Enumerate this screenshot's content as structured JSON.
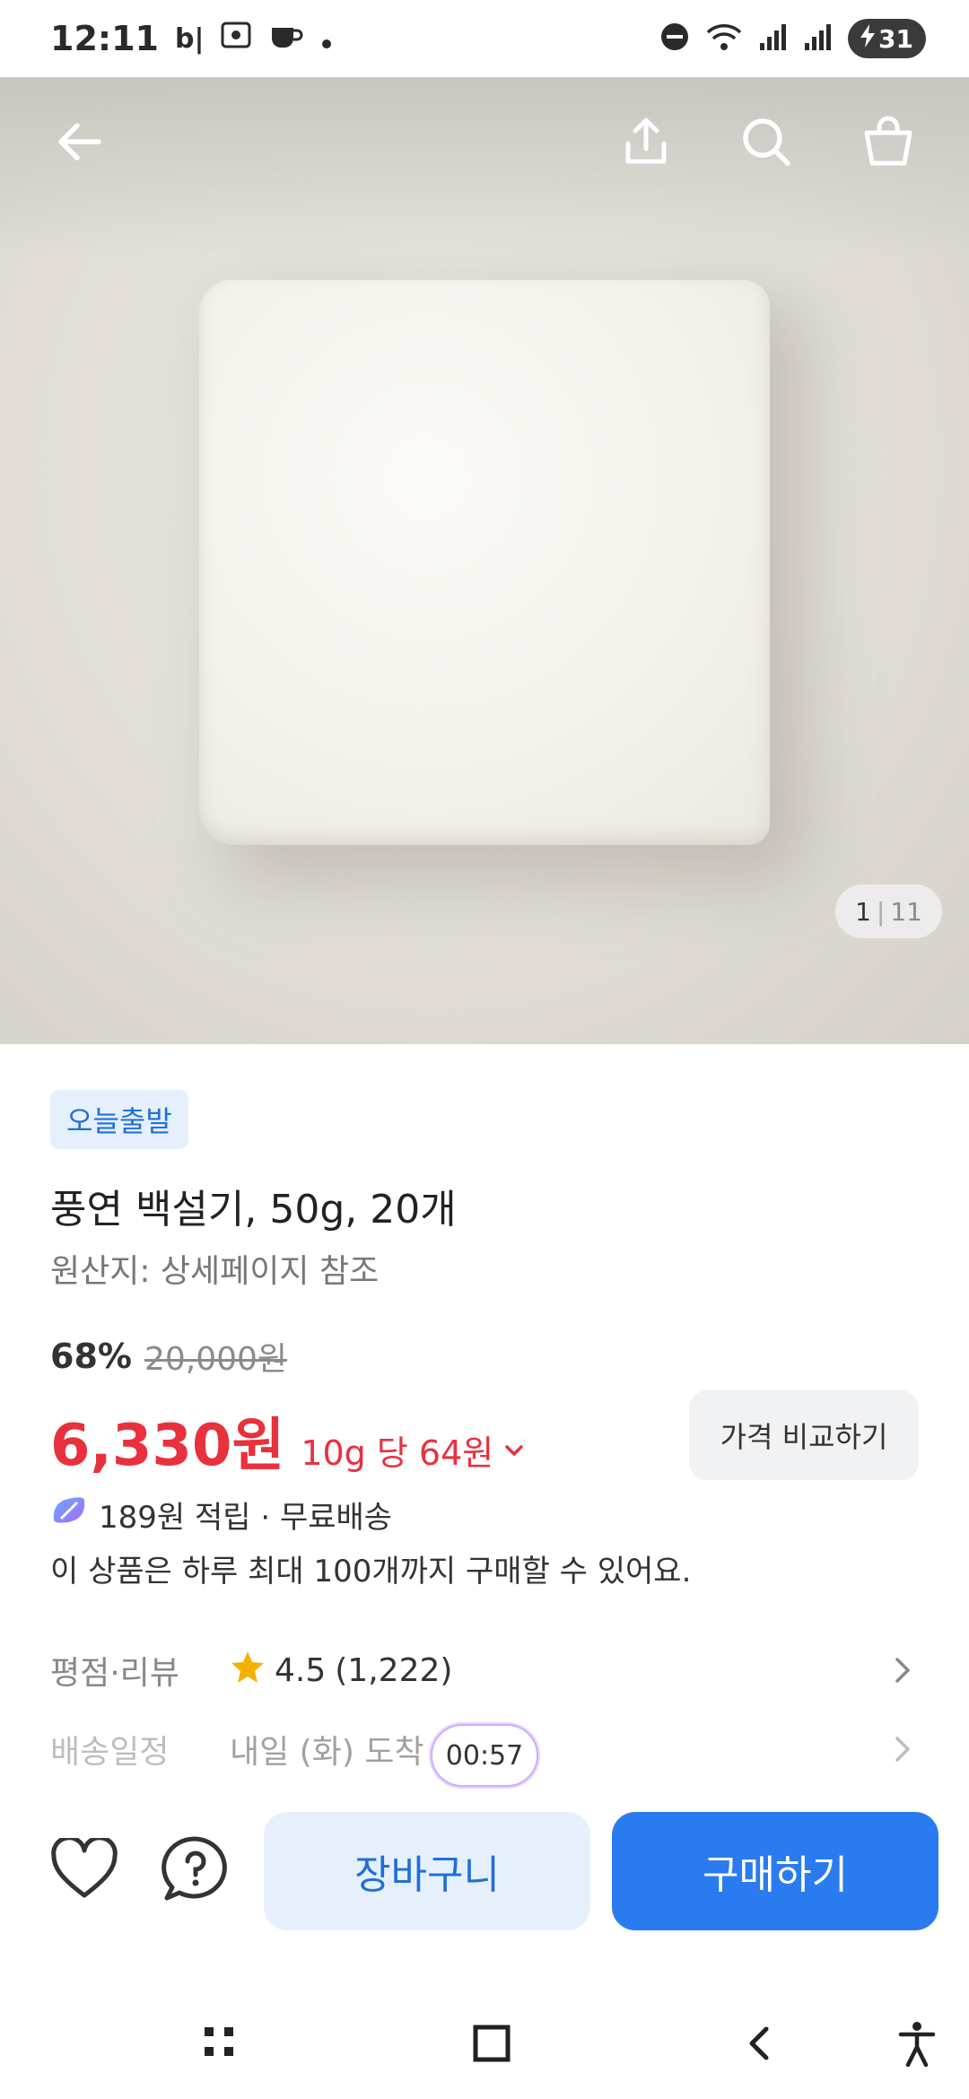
{
  "status_bar": {
    "time": "12:11",
    "carrier_glyph": "b|",
    "icons": [
      "screenshot-icon",
      "coffee-icon",
      "dot-icon",
      "dnd-icon",
      "wifi-icon",
      "signal-icon",
      "signal-icon"
    ],
    "battery_level": "31"
  },
  "hero": {
    "icons": {
      "back": "back-arrow-icon",
      "share": "share-icon",
      "search": "search-icon",
      "cart": "shopping-bag-icon"
    },
    "counter": {
      "current": "1",
      "separator": "|",
      "total": "11"
    }
  },
  "product": {
    "badge": "오늘출발",
    "title": "풍연 백설기, 50g, 20개",
    "origin": "원산지: 상세페이지 참조",
    "discount_rate": "68%",
    "original_price": "20,000원",
    "price": "6,330원",
    "unit_price": "10g 당 64원",
    "compare_label": "가격 비교하기",
    "points": "189원 적립 · 무료배송",
    "limit_text": "이 상품은 하루 최대 100개까지 구매할 수 있어요."
  },
  "review": {
    "label": "평점·리뷰",
    "rating": "4.5",
    "count": "(1,222)"
  },
  "delivery": {
    "label": "배송일정",
    "text": "내일 (화) 도착",
    "timer": "00:57"
  },
  "actions": {
    "cart_label": "장바구니",
    "buy_label": "구매하기"
  },
  "colors": {
    "accent": "#2a7bf0",
    "price_red": "#e8313d",
    "badge_bg": "#e6f0fd",
    "star": "#f5b100"
  }
}
